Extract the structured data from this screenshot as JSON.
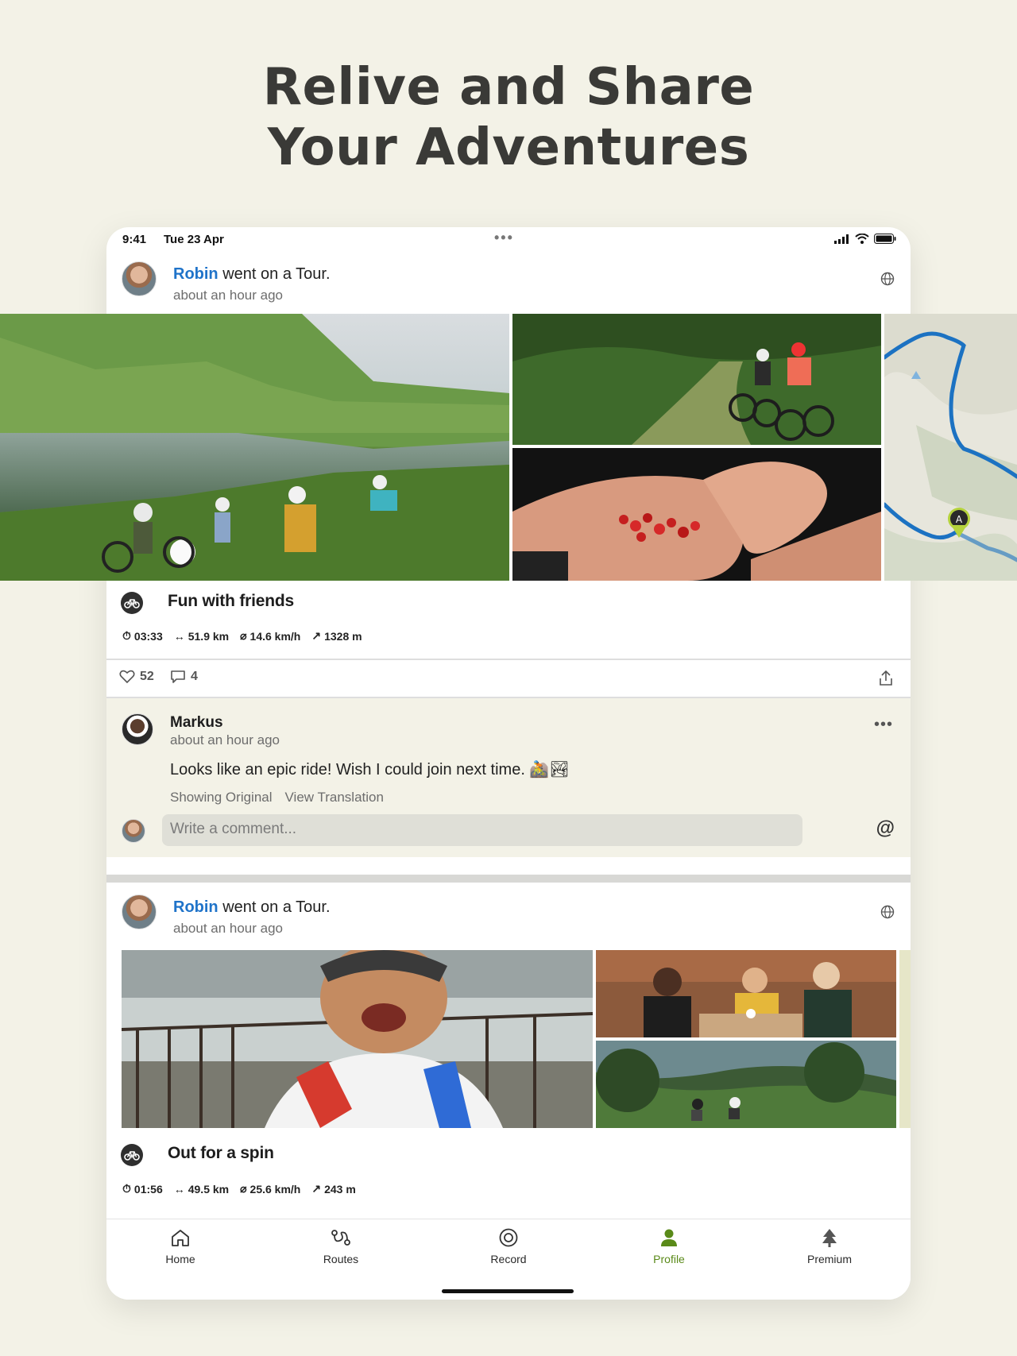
{
  "headline": {
    "line1": "Relive and Share",
    "line2": "Your Adventures"
  },
  "status": {
    "time": "9:41",
    "date": "Tue 23 Apr",
    "dots": "•••"
  },
  "posts": [
    {
      "user": "Robin",
      "action": " went on a Tour.",
      "ago": "about an hour ago",
      "title": "Fun with friends",
      "stats": {
        "duration": "03:33",
        "distance": "51.9 km",
        "speed": "14.6 km/h",
        "elevation": "1328 m"
      },
      "likes": "52",
      "comments": "4"
    },
    {
      "user": "Robin",
      "action": " went on a Tour.",
      "ago": "about an hour ago",
      "title": "Out for a spin",
      "stats": {
        "duration": "01:56",
        "distance": "49.5 km",
        "speed": "25.6 km/h",
        "elevation": "243 m"
      }
    }
  ],
  "comment": {
    "name": "Markus",
    "ago": "about an hour ago",
    "text": "Looks like an epic ride! Wish I could join next time. 🚵🏞",
    "showing": "Showing Original",
    "translate": "View Translation",
    "more": "•••",
    "placeholder": "Write a comment...",
    "at": "@"
  },
  "map": {
    "marker": "A"
  },
  "tabs": [
    {
      "label": "Home",
      "icon": "home-icon"
    },
    {
      "label": "Routes",
      "icon": "routes-icon"
    },
    {
      "label": "Record",
      "icon": "record-icon"
    },
    {
      "label": "Profile",
      "icon": "profile-icon",
      "active": true
    },
    {
      "label": "Premium",
      "icon": "premium-icon"
    }
  ],
  "colors": {
    "accent": "#5a8a19",
    "link": "#1f73c9",
    "background": "#f3f2e7"
  }
}
